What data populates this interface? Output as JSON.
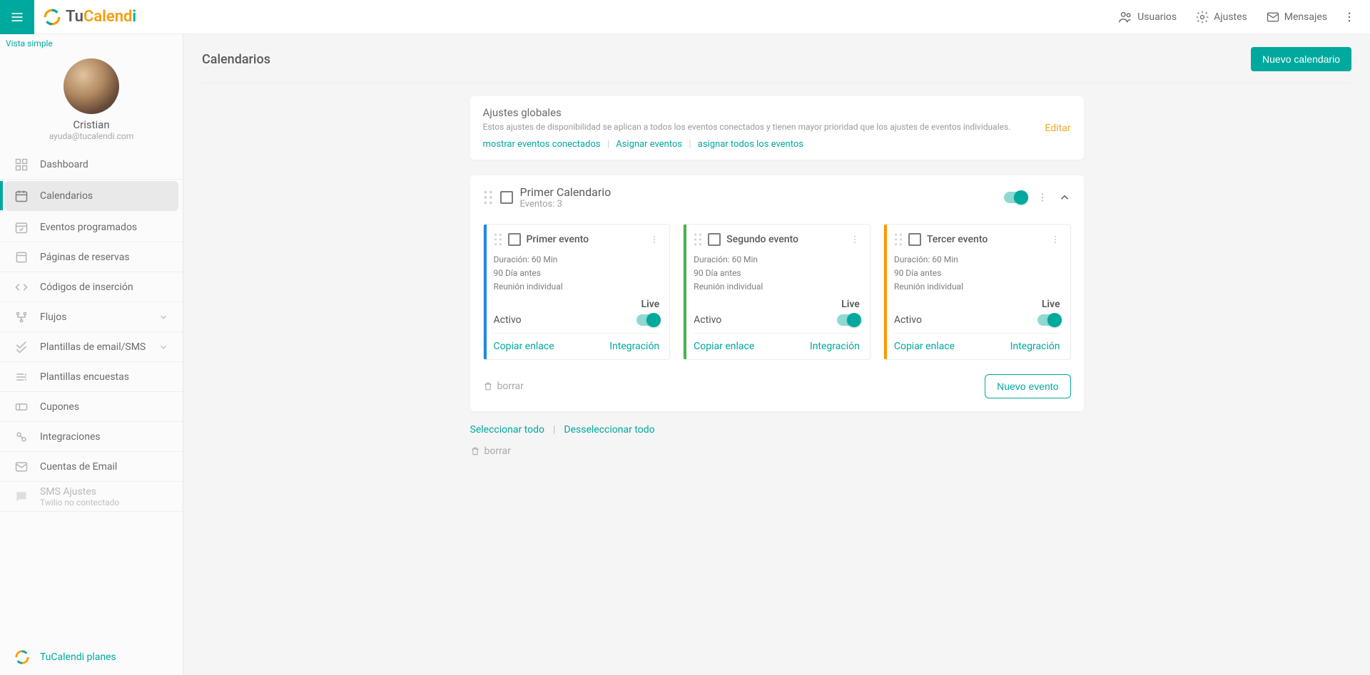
{
  "brand": {
    "tu": "Tu",
    "calend": "Calend",
    "i": "i"
  },
  "header_actions": {
    "users": "Usuarios",
    "settings": "Ajustes",
    "messages": "Mensajes"
  },
  "sidebar": {
    "vista_simple": "Vista simple",
    "profile": {
      "name": "Cristian",
      "email": "ayuda@tucalendi.com"
    },
    "items": [
      {
        "label": "Dashboard"
      },
      {
        "label": "Calendarios"
      },
      {
        "label": "Eventos programados"
      },
      {
        "label": "Páginas de reservas"
      },
      {
        "label": "Códigos de inserción"
      },
      {
        "label": "Flujos"
      },
      {
        "label": "Plantillas de email/SMS"
      },
      {
        "label": "Plantillas encuestas"
      },
      {
        "label": "Cupones"
      },
      {
        "label": "Integraciones"
      },
      {
        "label": "Cuentas de Email"
      },
      {
        "label": "SMS Ajustes",
        "sub": "Twilio no contectado"
      }
    ],
    "footer": "TuCalendi planes"
  },
  "page": {
    "title": "Calendarios",
    "new_calendar_btn": "Nuevo calendario"
  },
  "global": {
    "title": "Ajustes globales",
    "desc": "Estos ajustes de disponibilidad se aplican a todos los eventos conectados y tienen mayor prioridad que los ajustes de eventos individuales.",
    "link1": "mostrar eventos conectados",
    "link2": "Asignar eventos",
    "link3": "asignar todos los eventos",
    "edit": "Editar"
  },
  "calendar": {
    "title": "Primer Calendario",
    "subtitle": "Eventos: 3",
    "events": [
      {
        "title": "Primer evento",
        "duration": "Duración: 60 Min",
        "days": "90 Día antes",
        "type": "Reunión individual",
        "live": "Live",
        "active": "Activo",
        "copy": "Copiar enlace",
        "integration": "Integración",
        "border": "b-blue"
      },
      {
        "title": "Segundo evento",
        "duration": "Duración: 60 Min",
        "days": "90 Día antes",
        "type": "Reunión individual",
        "live": "Live",
        "active": "Activo",
        "copy": "Copiar enlace",
        "integration": "Integración",
        "border": "b-green"
      },
      {
        "title": "Tercer evento",
        "duration": "Duración: 60 Min",
        "days": "90 Día antes",
        "type": "Reunión individual",
        "live": "Live",
        "active": "Activo",
        "copy": "Copiar enlace",
        "integration": "Integración",
        "border": "b-orange"
      }
    ],
    "delete": "borrar",
    "new_event_btn": "Nuevo evento"
  },
  "selection": {
    "select_all": "Seleccionar todo",
    "deselect_all": "Desseleccionar todo",
    "delete": "borrar"
  }
}
